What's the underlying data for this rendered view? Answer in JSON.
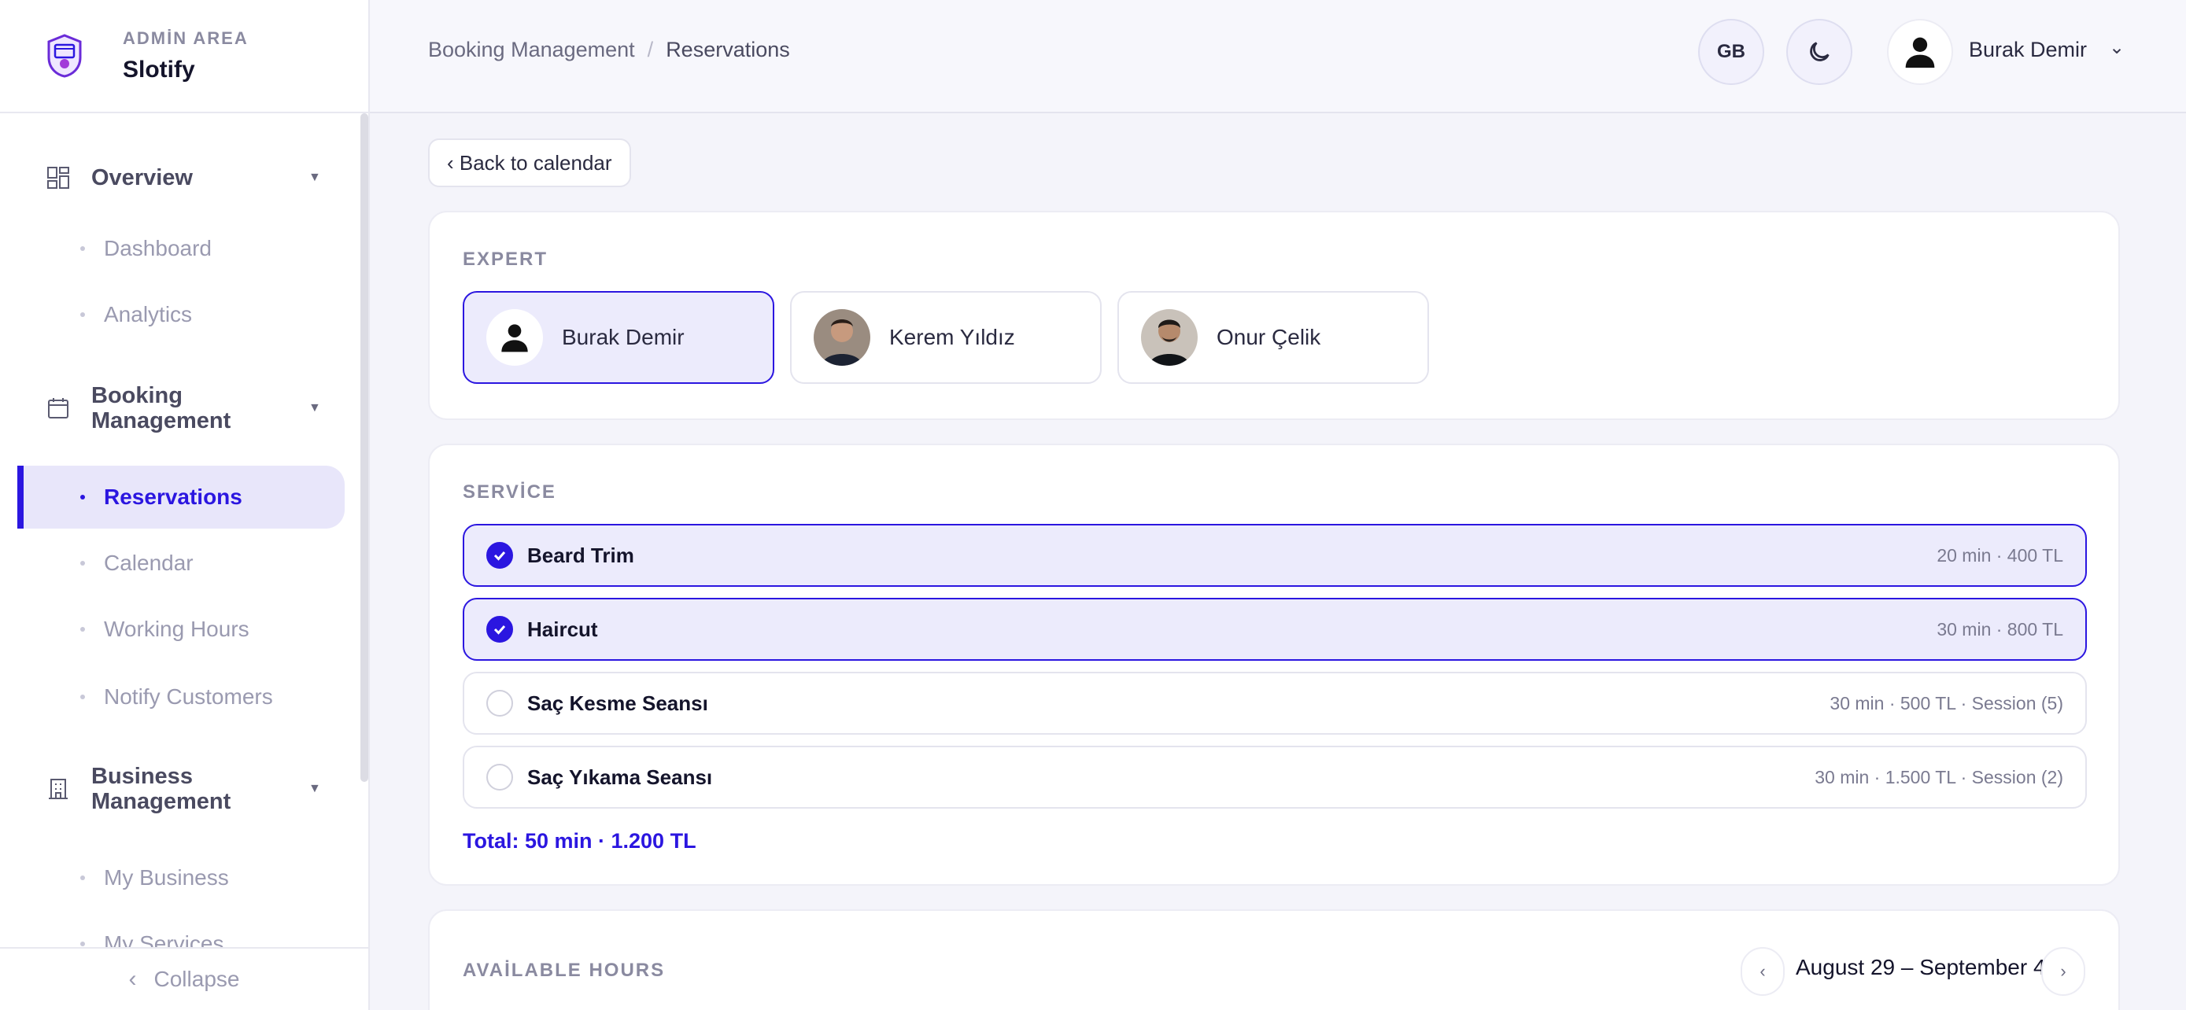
{
  "brand": {
    "sub": "ADMİN AREA",
    "name": "Slotify"
  },
  "sidebar": {
    "groups": [
      {
        "label": "Overview",
        "icon": "dashboard-icon"
      },
      {
        "label": "Booking Management",
        "icon": "calendar-icon"
      },
      {
        "label": "Business Management",
        "icon": "building-icon"
      }
    ],
    "items": [
      {
        "label": "Dashboard"
      },
      {
        "label": "Analytics"
      },
      {
        "label": "Reservations",
        "active": true
      },
      {
        "label": "Calendar"
      },
      {
        "label": "Working Hours"
      },
      {
        "label": "Notify Customers"
      },
      {
        "label": "My Business"
      },
      {
        "label": "My Services"
      }
    ],
    "collapse_label": "Collapse"
  },
  "header": {
    "breadcrumb": [
      "Booking Management",
      "Reservations"
    ],
    "separator": "/",
    "lang": "GB",
    "user_name": "Burak Demir"
  },
  "back_label": "‹ Back to calendar",
  "expert": {
    "title": "EXPERT",
    "options": [
      {
        "name": "Burak Demir",
        "selected": true
      },
      {
        "name": "Kerem Yıldız",
        "selected": false
      },
      {
        "name": "Onur Çelik",
        "selected": false
      }
    ]
  },
  "service": {
    "title": "SERVİCE",
    "options": [
      {
        "name": "Beard Trim",
        "meta": "20 min · 400 TL",
        "selected": true
      },
      {
        "name": "Haircut",
        "meta": "30 min · 800 TL",
        "selected": true
      },
      {
        "name": "Saç Kesme Seansı",
        "meta": "30 min · 500 TL · Session (5)",
        "selected": false
      },
      {
        "name": "Saç Yıkama Seansı",
        "meta": "30 min · 1.500 TL · Session (2)",
        "selected": false
      }
    ],
    "total": "Total: 50 min · 1.200 TL"
  },
  "hours": {
    "title": "AVAİLABLE HOURS",
    "range": "August 29 – September 4",
    "prev": "‹",
    "next": "›"
  },
  "colors": {
    "accent": "#2b16e0",
    "selected_bg": "#ecebfc"
  }
}
